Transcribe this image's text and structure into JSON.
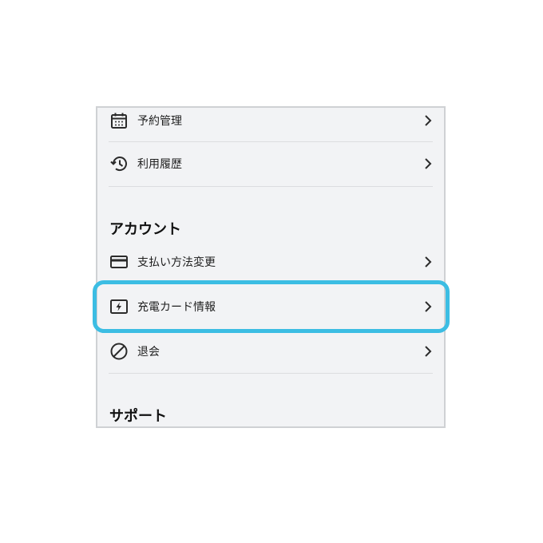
{
  "menu": {
    "items": [
      {
        "label": "予約管理",
        "icon": "calendar-icon"
      },
      {
        "label": "利用履歴",
        "icon": "history-icon"
      }
    ]
  },
  "account": {
    "title": "アカウント",
    "items": [
      {
        "label": "支払い方法変更",
        "icon": "credit-card-icon"
      },
      {
        "label": "充電カード情報",
        "icon": "charge-card-icon"
      },
      {
        "label": "退会",
        "icon": "prohibited-icon"
      }
    ]
  },
  "support": {
    "title": "サポート"
  },
  "colors": {
    "highlight": "#3cbde3",
    "background": "#f2f3f5",
    "divider": "#dcdde0",
    "icon": "#2b2b2b"
  }
}
